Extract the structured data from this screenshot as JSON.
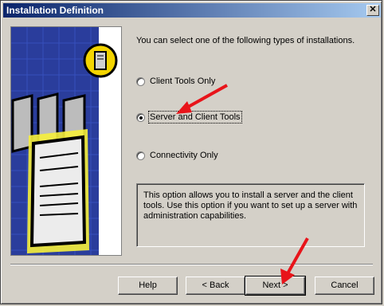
{
  "window": {
    "title": "Installation Definition"
  },
  "prompt": "You can select one of the following types of installations.",
  "options": [
    {
      "label": "Client Tools Only",
      "selected": false
    },
    {
      "label": "Server and Client Tools",
      "selected": true
    },
    {
      "label": "Connectivity Only",
      "selected": false
    }
  ],
  "description": "This option allows you to install a server and the client tools. Use this option if you want to set up a server with administration capabilities.",
  "buttons": {
    "help": "Help",
    "back": "< Back",
    "next": "Next >",
    "cancel": "Cancel"
  },
  "colors": {
    "titlebar": "#0a246a",
    "annotation_arrow": "#e8141a",
    "server_glow": "#f6f03a"
  }
}
